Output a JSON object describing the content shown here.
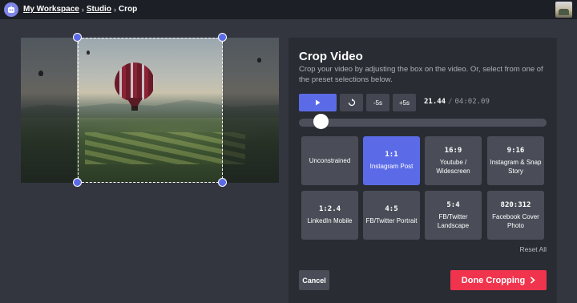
{
  "header": {
    "breadcrumbs": [
      "My Workspace",
      "Studio",
      "Crop"
    ],
    "separator": "›",
    "logo_icon": "robot-logo-icon",
    "avatar_icon": "user-avatar-icon"
  },
  "editor": {
    "title": "Crop Video",
    "description": "Crop your video by adjusting the box on the video. Or, select from one of the preset selections below."
  },
  "controls": {
    "play_icon": "play-icon",
    "replay_icon": "replay-icon",
    "back5": "-5s",
    "fwd5": "+5s",
    "current_time": "21.44",
    "time_separator": "/",
    "total_time": "04:02.09",
    "progress_fraction": 0.09
  },
  "presets": [
    {
      "ratio": "",
      "label": "Unconstrained",
      "active": false
    },
    {
      "ratio": "1:1",
      "label": "Instagram Post",
      "active": true
    },
    {
      "ratio": "16:9",
      "label": "Youtube / Widescreen",
      "active": false
    },
    {
      "ratio": "9:16",
      "label": "Instagram & Snap Story",
      "active": false
    },
    {
      "ratio": "1:2.4",
      "label": "LinkedIn Mobile",
      "active": false
    },
    {
      "ratio": "4:5",
      "label": "FB/Twitter Portrait",
      "active": false
    },
    {
      "ratio": "5:4",
      "label": "FB/Twitter Landscape",
      "active": false
    },
    {
      "ratio": "820:312",
      "label": "Facebook Cover Photo",
      "active": false
    }
  ],
  "actions": {
    "reset": "Reset All",
    "cancel": "Cancel",
    "done": "Done Cropping",
    "done_icon": "chevron-right-icon"
  },
  "colors": {
    "accent": "#5b6be8",
    "primary_action": "#f0344d"
  }
}
